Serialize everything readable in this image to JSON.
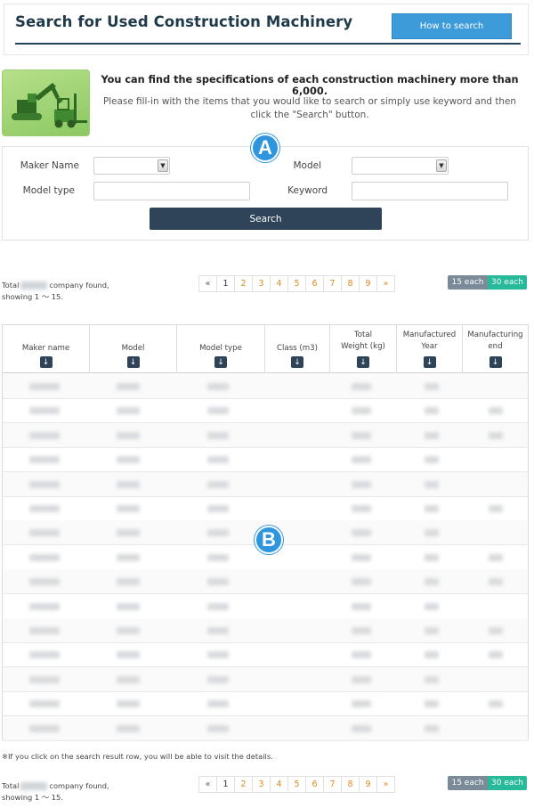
{
  "header": {
    "title": "Search for Used Construction Machinery",
    "how_button": "How to search"
  },
  "intro": {
    "headline": "You can find the specifications of each construction machinery more than 6,000.",
    "subtext": "Please fill-in with the items that you would like to search or simply use keyword and then click the \"Search\" button."
  },
  "search": {
    "maker_label": "Maker Name",
    "model_label": "Model",
    "model_type_label": "Model type",
    "keyword_label": "Keyword",
    "button": "Search"
  },
  "badges": {
    "a": "A",
    "b": "B"
  },
  "summary_top": {
    "prefix": "Total",
    "suffix": "company found,",
    "showing": "showing 1 ～ 15."
  },
  "summary_bottom": {
    "prefix": "Total",
    "suffix": "company found,",
    "showing": "showing 1 ～ 15."
  },
  "pagination": {
    "prev": "«",
    "pages": [
      "1",
      "2",
      "3",
      "4",
      "5",
      "6",
      "7",
      "8",
      "9"
    ],
    "current": "1",
    "next": "»"
  },
  "per_page": {
    "option_15": "15 each",
    "option_30": "30 each"
  },
  "table": {
    "columns": [
      {
        "line1": "Maker name",
        "line2": ""
      },
      {
        "line1": "Model",
        "line2": ""
      },
      {
        "line1": "Model type",
        "line2": ""
      },
      {
        "line1": "Class (m3)",
        "line2": ""
      },
      {
        "line1": "Total",
        "line2": "Weight (kg)"
      },
      {
        "line1": "Manufactured",
        "line2": "Year"
      },
      {
        "line1": "Manufacturing",
        "line2": "end"
      }
    ],
    "sort_icon": "↓",
    "row_count": 15
  },
  "note": "※If you click on the search result row, you will be able to visit the details."
}
